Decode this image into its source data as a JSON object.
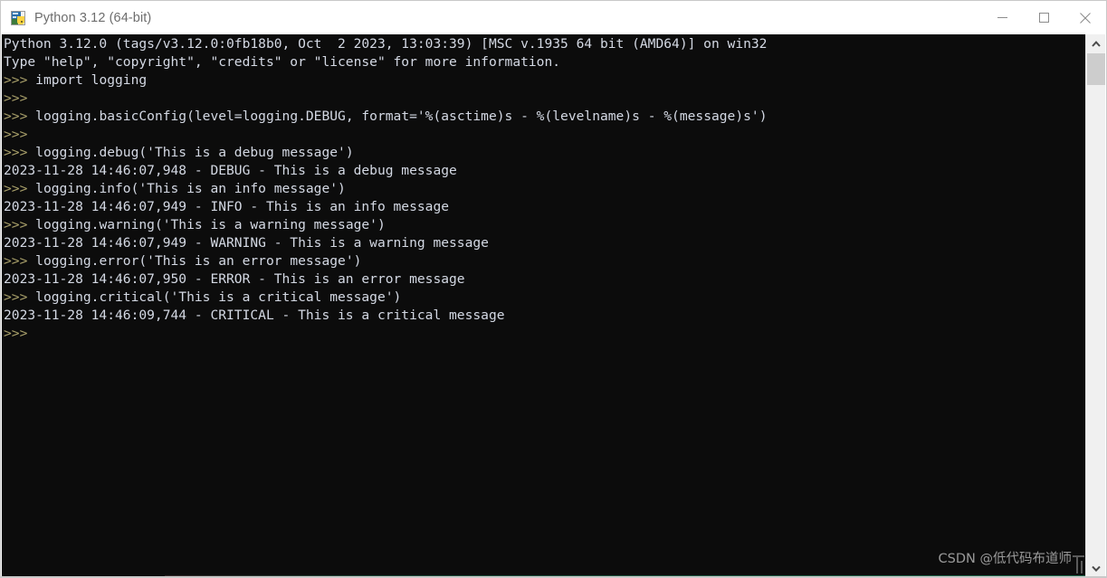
{
  "window": {
    "title": "Python 3.12 (64-bit)",
    "icon": "python-app-icon",
    "controls": {
      "minimize": "minimize-button",
      "maximize": "maximize-button",
      "close": "close-button"
    }
  },
  "console": {
    "background_color": "#0c0c0c",
    "text_color": "#d6dbe6",
    "prompt_color": "#a9a06a",
    "prompt": ">>>",
    "lines": [
      {
        "type": "output",
        "text": "Python 3.12.0 (tags/v3.12.0:0fb18b0, Oct  2 2023, 13:03:39) [MSC v.1935 64 bit (AMD64)] on win32"
      },
      {
        "type": "output",
        "text": "Type \"help\", \"copyright\", \"credits\" or \"license\" for more information."
      },
      {
        "type": "input",
        "prompt": ">>> ",
        "text": "import logging"
      },
      {
        "type": "input",
        "prompt": ">>> ",
        "text": ""
      },
      {
        "type": "input",
        "prompt": ">>> ",
        "text": "logging.basicConfig(level=logging.DEBUG, format='%(asctime)s - %(levelname)s - %(message)s')"
      },
      {
        "type": "input",
        "prompt": ">>> ",
        "text": ""
      },
      {
        "type": "input",
        "prompt": ">>> ",
        "text": "logging.debug('This is a debug message')"
      },
      {
        "type": "output",
        "text": "2023-11-28 14:46:07,948 - DEBUG - This is a debug message"
      },
      {
        "type": "input",
        "prompt": ">>> ",
        "text": "logging.info('This is an info message')"
      },
      {
        "type": "output",
        "text": "2023-11-28 14:46:07,949 - INFO - This is an info message"
      },
      {
        "type": "input",
        "prompt": ">>> ",
        "text": "logging.warning('This is a warning message')"
      },
      {
        "type": "output",
        "text": "2023-11-28 14:46:07,949 - WARNING - This is a warning message"
      },
      {
        "type": "input",
        "prompt": ">>> ",
        "text": "logging.error('This is an error message')"
      },
      {
        "type": "output",
        "text": "2023-11-28 14:46:07,950 - ERROR - This is an error message"
      },
      {
        "type": "input",
        "prompt": ">>> ",
        "text": "logging.critical('This is a critical message')"
      },
      {
        "type": "output",
        "text": "2023-11-28 14:46:09,744 - CRITICAL - This is a critical message"
      },
      {
        "type": "input",
        "prompt": ">>> ",
        "text": ""
      }
    ]
  },
  "watermark": {
    "text": "CSDN @低代码布道师"
  },
  "scrollbar": {
    "up_arrow": "chevron-up-icon",
    "down_arrow": "chevron-down-icon",
    "thumb": "scrollbar-thumb"
  }
}
